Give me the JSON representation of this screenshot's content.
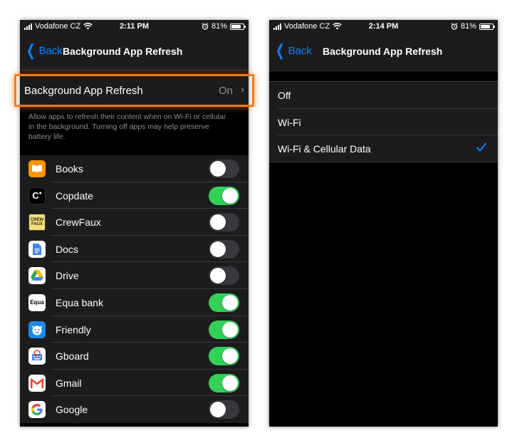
{
  "left": {
    "status": {
      "carrier": "Vodafone CZ",
      "time": "2:11 PM",
      "battery": "81%",
      "battery_level": 0.81
    },
    "nav": {
      "back_label": "Back",
      "title": "Background App Refresh"
    },
    "setting": {
      "label": "Background App Refresh",
      "value": "On"
    },
    "footer": "Allow apps to refresh their content when on Wi-Fi or cellular in the background. Turning off apps may help preserve battery life.",
    "apps": [
      {
        "name": "Books",
        "on": false,
        "icon": "books-icon"
      },
      {
        "name": "Copdate",
        "on": true,
        "icon": "copdate-icon"
      },
      {
        "name": "CrewFaux",
        "on": false,
        "icon": "crewfaux-icon"
      },
      {
        "name": "Docs",
        "on": false,
        "icon": "docs-icon"
      },
      {
        "name": "Drive",
        "on": false,
        "icon": "drive-icon"
      },
      {
        "name": "Equa bank",
        "on": true,
        "icon": "equa-bank-icon"
      },
      {
        "name": "Friendly",
        "on": true,
        "icon": "friendly-icon"
      },
      {
        "name": "Gboard",
        "on": true,
        "icon": "gboard-icon"
      },
      {
        "name": "Gmail",
        "on": true,
        "icon": "gmail-icon"
      },
      {
        "name": "Google",
        "on": false,
        "icon": "google-icon"
      }
    ]
  },
  "right": {
    "status": {
      "carrier": "Vodafone CZ",
      "time": "2:14 PM",
      "battery": "81%",
      "battery_level": 0.81
    },
    "nav": {
      "back_label": "Back",
      "title": "Background App Refresh"
    },
    "options": [
      {
        "label": "Off",
        "selected": false
      },
      {
        "label": "Wi-Fi",
        "selected": false
      },
      {
        "label": "Wi-Fi & Cellular Data",
        "selected": true
      }
    ]
  },
  "colors": {
    "accent": "#0a84ff",
    "toggle_on": "#32d158",
    "highlight": "#f27c18"
  },
  "icon_text": {
    "copdate": "C",
    "crewfaux": "CREW FAUX",
    "equa": "Equa"
  }
}
